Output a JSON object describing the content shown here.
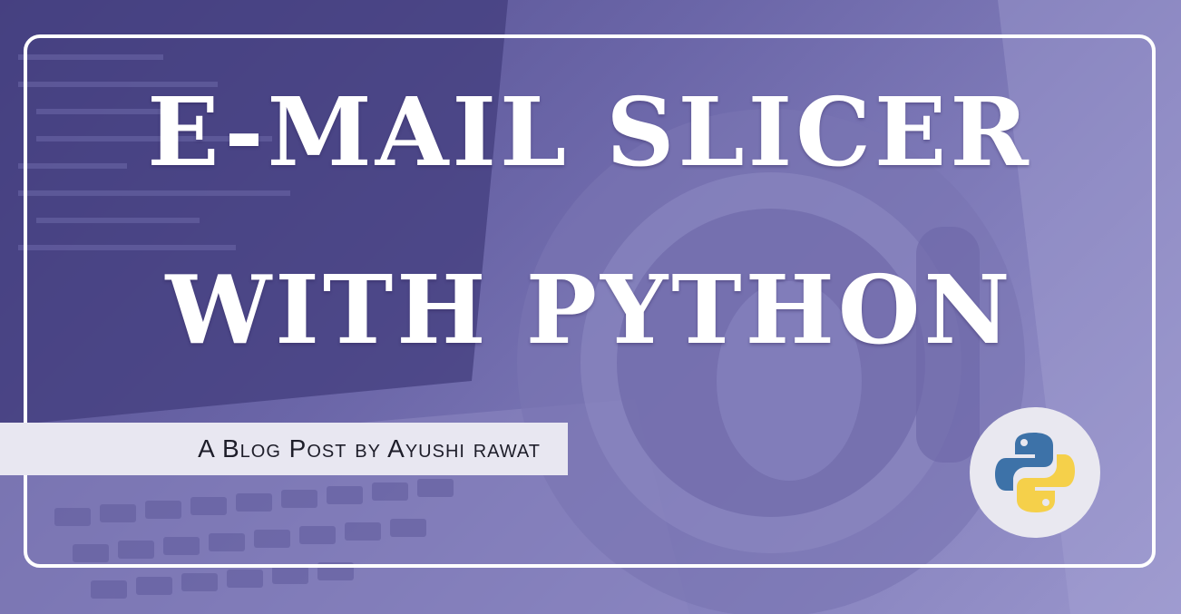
{
  "title": {
    "line1": "E-MAIL SLICER",
    "line2": "WITH PYTHON"
  },
  "byline": "A Blog Post by Ayushi rawat",
  "logo": {
    "icon": "python-logo-icon"
  },
  "colors": {
    "background": "#6b66a8",
    "frame": "#ffffff",
    "byline_bar": "#e8e7f1",
    "python_blue": "#3d72a8",
    "python_yellow": "#f5d04a"
  }
}
